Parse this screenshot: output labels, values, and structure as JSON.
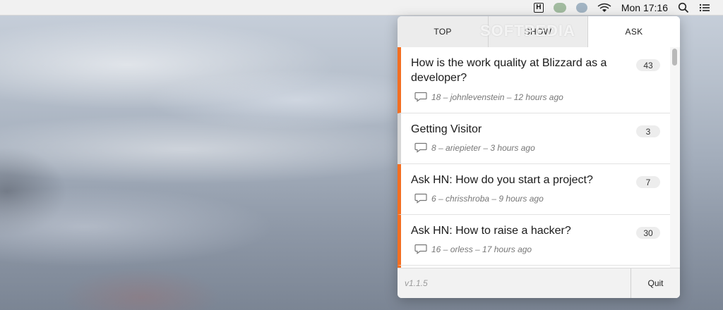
{
  "menubar": {
    "h_label": "H",
    "clock": "Mon 17:16",
    "icons": [
      "h-app-icon",
      "status-icon-green",
      "status-icon-blue",
      "wifi-icon",
      "search-icon",
      "list-icon"
    ]
  },
  "watermark": "SOFTPEDIA",
  "tabs": [
    {
      "label": "TOP"
    },
    {
      "label": "SHOW"
    },
    {
      "label": "ASK",
      "active": true
    }
  ],
  "items": [
    {
      "title": "How is the work quality at Blizzard as a developer?",
      "points": "43",
      "meta": "18 – johnlevenstein – 12 hours ago",
      "hot": true
    },
    {
      "title": "Getting Visitor",
      "points": "3",
      "meta": "8 – ariepieter – 3 hours ago",
      "hot": false
    },
    {
      "title": "Ask HN: How do you start a project?",
      "points": "7",
      "meta": "6 – chrisshroba – 9 hours ago",
      "hot": true
    },
    {
      "title": "Ask HN: How to raise a hacker?",
      "points": "30",
      "meta": "16 – orless – 17 hours ago",
      "hot": true
    }
  ],
  "footer": {
    "version": "v1.1.5",
    "quit_label": "Quit"
  },
  "colors": {
    "accent": "#f36f22",
    "inactive_marker": "#d6d6d6"
  }
}
